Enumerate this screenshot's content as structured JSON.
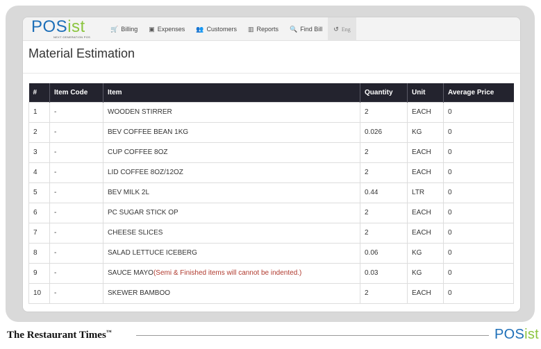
{
  "app": {
    "logo": {
      "main": "POS",
      "accent": "ist",
      "tagline": "NEXT GENERATION POS"
    },
    "nav": [
      {
        "icon": "cart-icon",
        "glyph": "🛒",
        "label": "Billing"
      },
      {
        "icon": "money-icon",
        "glyph": "▣",
        "label": "Expenses"
      },
      {
        "icon": "users-icon",
        "glyph": "👥",
        "label": "Customers"
      },
      {
        "icon": "chart-icon",
        "glyph": "▥",
        "label": "Reports"
      },
      {
        "icon": "search-icon",
        "glyph": "🔍",
        "label": "Find Bill"
      },
      {
        "icon": "language-icon",
        "glyph": "↺",
        "label": "Eng"
      }
    ]
  },
  "page": {
    "title": "Material Estimation"
  },
  "table": {
    "columns": [
      "#",
      "Item Code",
      "Item",
      "Quantity",
      "Unit",
      "Average Price"
    ],
    "rows": [
      {
        "num": "1",
        "code": "-",
        "item": "WOODEN STIRRER",
        "note": "",
        "qty": "2",
        "unit": "EACH",
        "price": "0"
      },
      {
        "num": "2",
        "code": "-",
        "item": "BEV COFFEE BEAN 1KG",
        "note": "",
        "qty": "0.026",
        "unit": "KG",
        "price": "0"
      },
      {
        "num": "3",
        "code": "-",
        "item": "CUP COFFEE 8OZ",
        "note": "",
        "qty": "2",
        "unit": "EACH",
        "price": "0"
      },
      {
        "num": "4",
        "code": "-",
        "item": "LID COFFEE 8OZ/12OZ",
        "note": "",
        "qty": "2",
        "unit": "EACH",
        "price": "0"
      },
      {
        "num": "5",
        "code": "-",
        "item": "BEV MILK 2L",
        "note": "",
        "qty": "0.44",
        "unit": "LTR",
        "price": "0"
      },
      {
        "num": "6",
        "code": "-",
        "item": "PC SUGAR STICK OP",
        "note": "",
        "qty": "2",
        "unit": "EACH",
        "price": "0"
      },
      {
        "num": "7",
        "code": "-",
        "item": "CHEESE SLICES",
        "note": "",
        "qty": "2",
        "unit": "EACH",
        "price": "0"
      },
      {
        "num": "8",
        "code": "-",
        "item": "SALAD LETTUCE ICEBERG",
        "note": "",
        "qty": "0.06",
        "unit": "KG",
        "price": "0"
      },
      {
        "num": "9",
        "code": "-",
        "item": "SAUCE MAYO",
        "note": "(Semi & Finished items will cannot be indented.)",
        "qty": "0.03",
        "unit": "KG",
        "price": "0"
      },
      {
        "num": "10",
        "code": "-",
        "item": "SKEWER BAMBOO",
        "note": "",
        "qty": "2",
        "unit": "EACH",
        "price": "0"
      }
    ]
  },
  "footer": {
    "publication": "The Restaurant Times",
    "trademark": "™",
    "brand_main": "POS",
    "brand_accent": "ist"
  },
  "colors": {
    "header_bg": "#23232e",
    "logo_blue": "#1d6fb8",
    "logo_green": "#8bc53f",
    "note_red": "#b03a2e"
  }
}
